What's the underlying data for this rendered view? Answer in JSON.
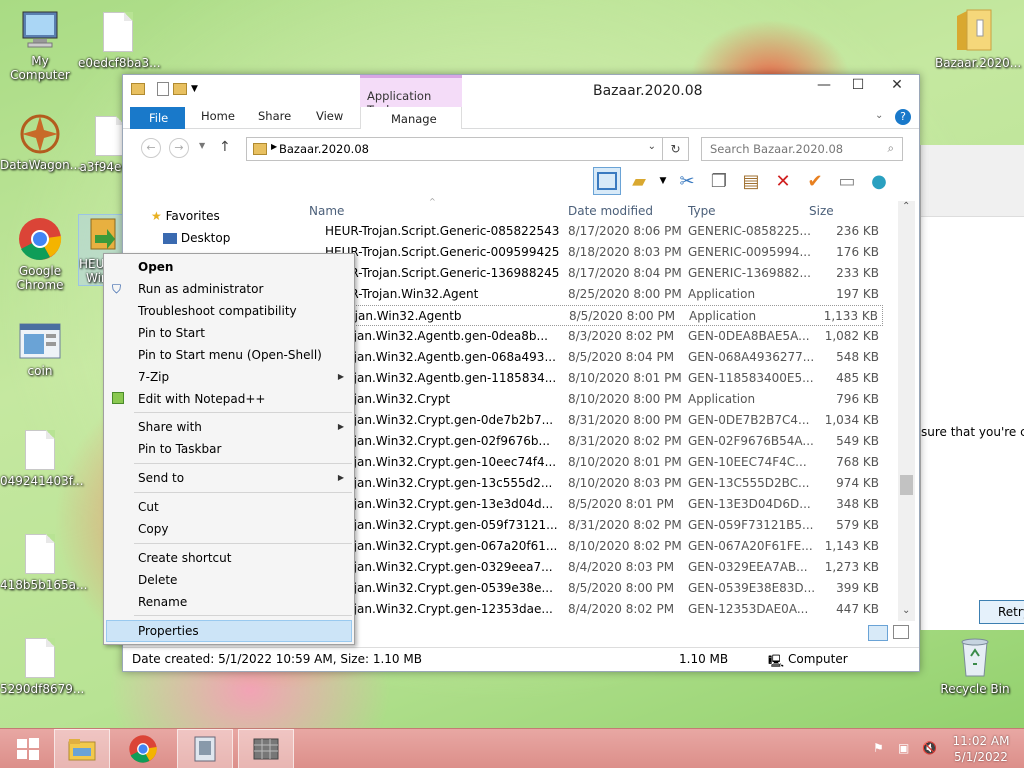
{
  "desktop": {
    "icons": [
      {
        "label": "My Computer"
      },
      {
        "label": "e0edcf8ba3..."
      },
      {
        "label": "DataWagon..."
      },
      {
        "label": "a3f94e4..."
      },
      {
        "label": "Google Chrome"
      },
      {
        "label": "HEUR-... Win..."
      },
      {
        "label": "coin"
      },
      {
        "label": "049241403f..."
      },
      {
        "label": "418b5b165a..."
      },
      {
        "label": "5290df8679..."
      },
      {
        "label": "Bazaar.2020..."
      },
      {
        "label": "Recycle Bin"
      }
    ],
    "bg_dialog": {
      "message": "sure that you're con",
      "retry_label": "Retry"
    }
  },
  "window": {
    "title": "Bazaar.2020.08",
    "contextual_tab": "Application Tools",
    "ribbon_tabs": {
      "file": "File",
      "home": "Home",
      "share": "Share",
      "view": "View",
      "manage": "Manage"
    },
    "address": "Bazaar.2020.08",
    "search_placeholder": "Search Bazaar.2020.08",
    "nav": {
      "favorites": "Favorites",
      "desktop": "Desktop"
    },
    "columns": {
      "name": "Name",
      "date": "Date modified",
      "type": "Type",
      "size": "Size"
    },
    "files": [
      {
        "name": "HEUR-Trojan.Script.Generic-0858225435e...",
        "date": "8/17/2020 8:06 PM",
        "type": "GENERIC-0858225...",
        "size": "236 KB"
      },
      {
        "name": "HEUR-Trojan.Script.Generic-00959942584...",
        "date": "8/18/2020 8:03 PM",
        "type": "GENERIC-0095994...",
        "size": "176 KB"
      },
      {
        "name": "HEUR-Trojan.Script.Generic-13698824549...",
        "date": "8/17/2020 8:04 PM",
        "type": "GENERIC-1369882...",
        "size": "233 KB"
      },
      {
        "name": "HEUR-Trojan.Win32.Agent",
        "date": "8/25/2020 8:00 PM",
        "type": "Application",
        "size": "197 KB"
      },
      {
        "name": "R-Trojan.Win32.Agentb",
        "date": "8/5/2020 8:00 PM",
        "type": "Application",
        "size": "1,133 KB"
      },
      {
        "name": "R-Trojan.Win32.Agentb.gen-0dea8b...",
        "date": "8/3/2020 8:02 PM",
        "type": "GEN-0DEA8BAE5A...",
        "size": "1,082 KB"
      },
      {
        "name": "R-Trojan.Win32.Agentb.gen-068a493...",
        "date": "8/5/2020 8:04 PM",
        "type": "GEN-068A4936277...",
        "size": "548 KB"
      },
      {
        "name": "R-Trojan.Win32.Agentb.gen-1185834...",
        "date": "8/10/2020 8:01 PM",
        "type": "GEN-118583400E5...",
        "size": "485 KB"
      },
      {
        "name": "R-Trojan.Win32.Crypt",
        "date": "8/10/2020 8:00 PM",
        "type": "Application",
        "size": "796 KB"
      },
      {
        "name": "R-Trojan.Win32.Crypt.gen-0de7b2b7...",
        "date": "8/31/2020 8:00 PM",
        "type": "GEN-0DE7B2B7C4...",
        "size": "1,034 KB"
      },
      {
        "name": "R-Trojan.Win32.Crypt.gen-02f9676b...",
        "date": "8/31/2020 8:02 PM",
        "type": "GEN-02F9676B54A...",
        "size": "549 KB"
      },
      {
        "name": "R-Trojan.Win32.Crypt.gen-10eec74f4...",
        "date": "8/10/2020 8:01 PM",
        "type": "GEN-10EEC74F4C...",
        "size": "768 KB"
      },
      {
        "name": "R-Trojan.Win32.Crypt.gen-13c555d2...",
        "date": "8/10/2020 8:03 PM",
        "type": "GEN-13C555D2BC...",
        "size": "974 KB"
      },
      {
        "name": "R-Trojan.Win32.Crypt.gen-13e3d04d...",
        "date": "8/5/2020 8:01 PM",
        "type": "GEN-13E3D04D6D...",
        "size": "348 KB"
      },
      {
        "name": "R-Trojan.Win32.Crypt.gen-059f73121...",
        "date": "8/31/2020 8:02 PM",
        "type": "GEN-059F73121B5...",
        "size": "579 KB"
      },
      {
        "name": "R-Trojan.Win32.Crypt.gen-067a20f61...",
        "date": "8/10/2020 8:02 PM",
        "type": "GEN-067A20F61FE...",
        "size": "1,143 KB"
      },
      {
        "name": "R-Trojan.Win32.Crypt.gen-0329eea7...",
        "date": "8/4/2020 8:03 PM",
        "type": "GEN-0329EEA7AB...",
        "size": "1,273 KB"
      },
      {
        "name": "R-Trojan.Win32.Crypt.gen-0539e38e...",
        "date": "8/5/2020 8:00 PM",
        "type": "GEN-0539E38E83D...",
        "size": "399 KB"
      },
      {
        "name": "R-Trojan.Win32.Crypt.gen-12353dae...",
        "date": "8/4/2020 8:02 PM",
        "type": "GEN-12353DAE0A...",
        "size": "447 KB"
      }
    ],
    "status": {
      "info": "Date created: 5/1/2022 10:59 AM, Size: 1.10 MB",
      "size": "1.10 MB",
      "location": "Computer"
    }
  },
  "context_menu": {
    "open": "Open",
    "run_admin": "Run as administrator",
    "troubleshoot": "Troubleshoot compatibility",
    "pin_start": "Pin to Start",
    "pin_start_menu": "Pin to Start menu (Open-Shell)",
    "zip": "7-Zip",
    "notepad": "Edit with Notepad++",
    "share": "Share with",
    "pin_taskbar": "Pin to Taskbar",
    "send_to": "Send to",
    "cut": "Cut",
    "copy": "Copy",
    "create_shortcut": "Create shortcut",
    "delete": "Delete",
    "rename": "Rename",
    "properties": "Properties"
  },
  "taskbar": {
    "time": "11:02 AM",
    "date": "5/1/2022"
  }
}
